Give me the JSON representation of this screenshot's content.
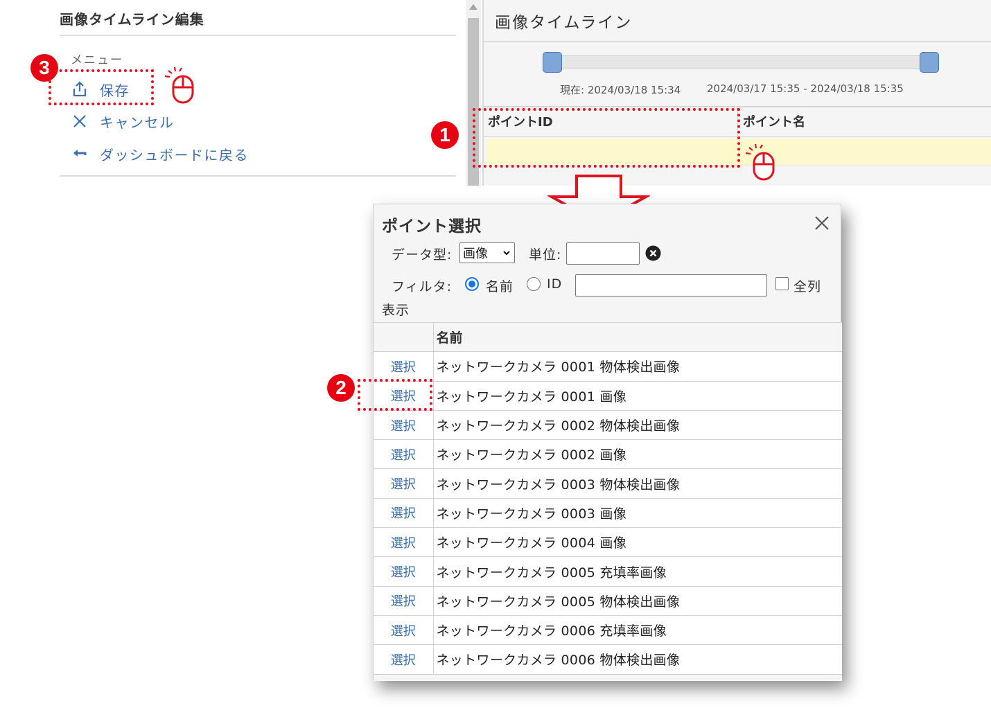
{
  "edit_panel": {
    "title": "画像タイムライン編集",
    "menu_heading": "メニュー",
    "save_label": "保存",
    "cancel_label": "キャンセル",
    "back_label": "ダッシュボードに戻る"
  },
  "timeline": {
    "title": "画像タイムライン",
    "current_label": "現在: 2024/03/18 15:34",
    "range_label": "2024/03/17 15:35 - 2024/03/18 15:35",
    "col_point_id": "ポイントID",
    "col_point_name": "ポイント名"
  },
  "annotations": {
    "badge1": "1",
    "badge2": "2",
    "badge3": "3"
  },
  "dialog": {
    "title": "ポイント選択",
    "data_type_label": "データ型:",
    "data_type_value": "画像",
    "unit_label": "単位:",
    "unit_value": "",
    "filter_label": "フィルタ:",
    "filter_name_label": "名前",
    "filter_id_label": "ID",
    "filter_value": "",
    "all_columns_label": "全列",
    "display_label": "表示",
    "col_name_header": "名前",
    "select_label": "選択",
    "rows": [
      "ネットワークカメラ 0001 物体検出画像",
      "ネットワークカメラ 0001 画像",
      "ネットワークカメラ 0002 物体検出画像",
      "ネットワークカメラ 0002 画像",
      "ネットワークカメラ 0003 物体検出画像",
      "ネットワークカメラ 0003 画像",
      "ネットワークカメラ 0004 画像",
      "ネットワークカメラ 0005 充填率画像",
      "ネットワークカメラ 0005 物体検出画像",
      "ネットワークカメラ 0006 充填率画像",
      "ネットワークカメラ 0006 物体検出画像"
    ]
  },
  "colors": {
    "link": "#3b6fae",
    "annotation_red": "#e60012",
    "highlight_row": "#fdf9cc",
    "slider_handle": "#7ea7d8"
  }
}
